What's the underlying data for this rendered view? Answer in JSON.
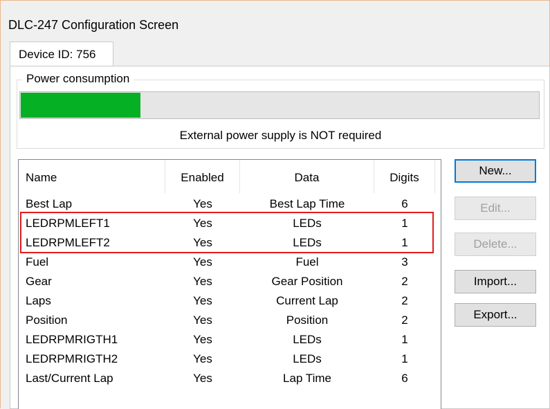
{
  "window": {
    "title": "DLC-247 Configuration Screen"
  },
  "tab": {
    "label": "Device ID: 756"
  },
  "power": {
    "group_label": "Power consumption",
    "progress_fraction": 0.23,
    "status_text": "External power supply is NOT required",
    "fill_color": "#06b025"
  },
  "list": {
    "columns": [
      "Name",
      "Enabled",
      "Data",
      "Digits"
    ],
    "rows": [
      [
        "Best Lap",
        "Yes",
        "Best Lap Time",
        "6"
      ],
      [
        "LEDRPMLEFT1",
        "Yes",
        "LEDs",
        "1"
      ],
      [
        "LEDRPMLEFT2",
        "Yes",
        "LEDs",
        "1"
      ],
      [
        "Fuel",
        "Yes",
        "Fuel",
        "3"
      ],
      [
        "Gear",
        "Yes",
        "Gear Position",
        "2"
      ],
      [
        "Laps",
        "Yes",
        "Current Lap",
        "2"
      ],
      [
        "Position",
        "Yes",
        "Position",
        "2"
      ],
      [
        "LEDRPMRIGTH1",
        "Yes",
        "LEDs",
        "1"
      ],
      [
        "LEDRPMRIGTH2",
        "Yes",
        "LEDs",
        "1"
      ],
      [
        "Last/Current Lap",
        "Yes",
        "Lap Time",
        "6"
      ]
    ],
    "highlight_color": "#e21b1b"
  },
  "buttons": {
    "new_label": "New...",
    "edit_label": "Edit...",
    "delete_label": "Delete...",
    "import_label": "Import...",
    "export_label": "Export..."
  }
}
